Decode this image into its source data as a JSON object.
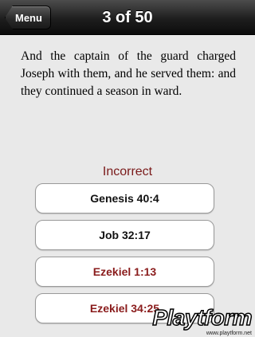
{
  "nav": {
    "back_label": "Menu",
    "title": "3 of 50"
  },
  "verse": {
    "text": "And the captain of the guard charged Joseph with them, and he served them: and they continued a season in ward."
  },
  "result": {
    "label": "Incorrect",
    "color": "#7a1a1a"
  },
  "answers": [
    {
      "label": "Genesis 40:4",
      "state": "normal"
    },
    {
      "label": "Job 32:17",
      "state": "normal"
    },
    {
      "label": "Ezekiel 1:13",
      "state": "wrong"
    },
    {
      "label": "Ezekiel 34:25",
      "state": "wrong"
    }
  ],
  "watermark": {
    "logo": "Playtform",
    "url": "www.playtform.net"
  }
}
